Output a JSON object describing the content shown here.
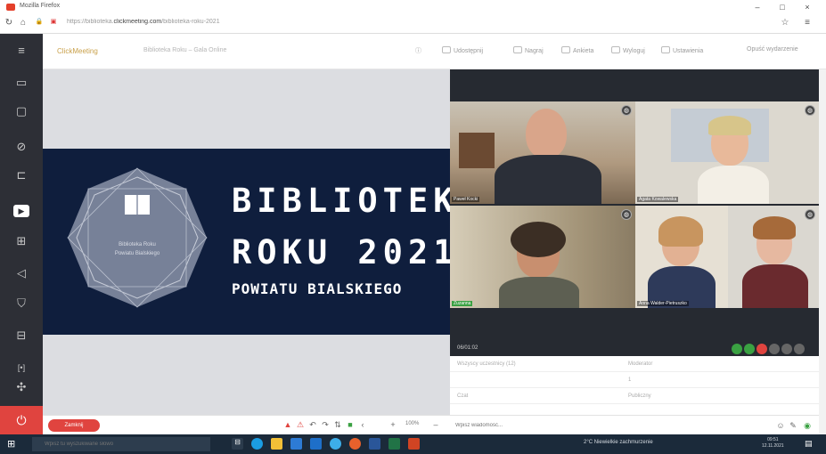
{
  "browser": {
    "window_title": "Mozilla Firefox",
    "url_prefix": "https://biblioteka.",
    "url_domain": "clickmeeting.com",
    "url_suffix": "/biblioteka-roku-2021"
  },
  "header": {
    "brand": "ClickMeeting",
    "room_name": "Biblioteka Roku – Gala Online",
    "buttons": [
      "Udostępnij",
      "Nagraj",
      "Ankieta",
      "Wyloguj",
      "Ustawienia",
      "Opuść wydarzenie"
    ]
  },
  "slide": {
    "line1": "BIBLIOTEKA",
    "line2": "ROKU 2021",
    "line3": "POWIATU BIALSKIEGO",
    "badge_line1": "Biblioteka Roku",
    "badge_line2": "Powiatu Bialskiego"
  },
  "slide_toolbar": {
    "close_label": "Zamknij",
    "zoom": "100%"
  },
  "video": {
    "tiles": [
      {
        "name": "Paweł Kocki"
      },
      {
        "name": "Agata Kowalewska"
      },
      {
        "name": "Zuzanna"
      },
      {
        "name": "Anna Walder-Pietruszko"
      },
      {
        "name": ""
      }
    ],
    "controls_label": "06/01:02"
  },
  "sidelist": {
    "rows": [
      {
        "left": "Wszyscy uczestnicy (12)",
        "right": "Moderator"
      },
      {
        "left": "",
        "right": "1"
      },
      {
        "left": "Czat",
        "right": "Publiczny"
      }
    ],
    "chat_placeholder": "Wpisz wiadomość..."
  },
  "taskbar": {
    "search_placeholder": "Wpisz tu wyszukiwane słowo",
    "weather": "2°C Niewielkie zachmurzenie",
    "time": "09:51",
    "date": "12.11.2021"
  },
  "colors": {
    "rail": "#2d2f36",
    "slide_bg": "#0f1e3d",
    "accent_red": "#e0443f",
    "stage_bg": "#dcdde1",
    "video_bg": "#262a31"
  }
}
